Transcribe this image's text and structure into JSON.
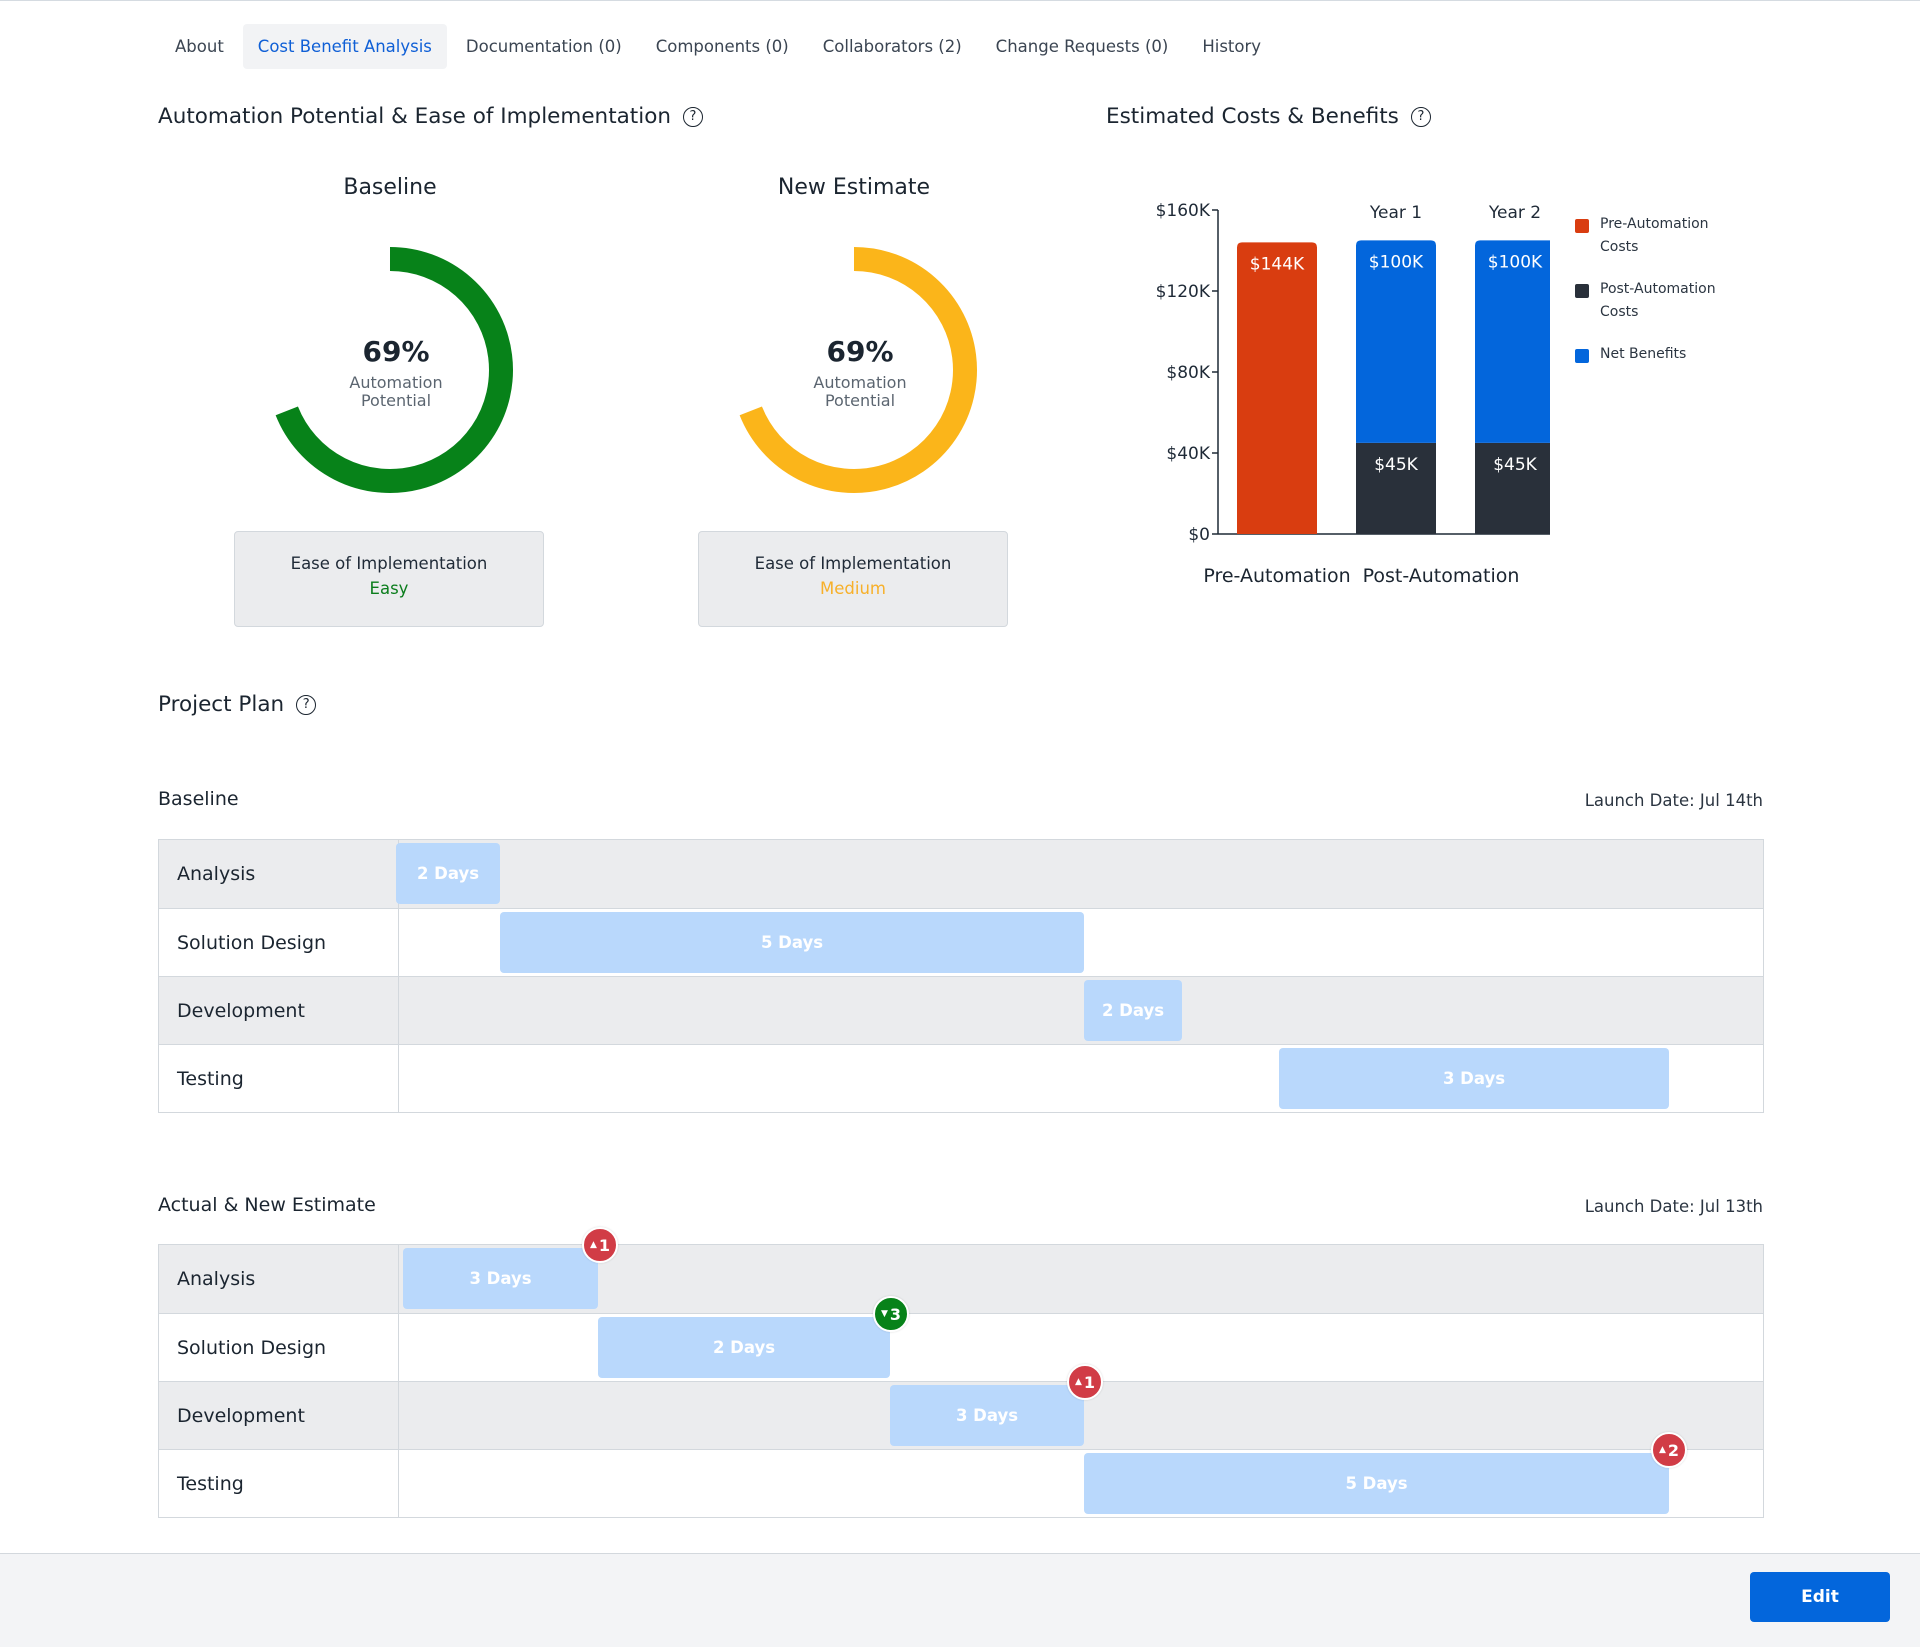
{
  "tabs": [
    {
      "label": "About",
      "active": false
    },
    {
      "label": "Cost Benefit Analysis",
      "active": true
    },
    {
      "label": "Documentation (0)",
      "active": false
    },
    {
      "label": "Components (0)",
      "active": false
    },
    {
      "label": "Collaborators (2)",
      "active": false
    },
    {
      "label": "Change Requests (0)",
      "active": false
    },
    {
      "label": "History",
      "active": false
    }
  ],
  "automation": {
    "heading": "Automation Potential & Ease of Implementation",
    "help_icon": "question-circle-icon",
    "help_glyph": "?",
    "baseline": {
      "title": "Baseline",
      "percent_label": "69%",
      "percent": 69,
      "sub_line1": "Automation",
      "sub_line2": "Potential",
      "color": "#078219",
      "ease_label": "Ease of Implementation",
      "ease_value": "Easy",
      "ease_color": "#0b7d1c"
    },
    "new_estimate": {
      "title": "New Estimate",
      "percent_label": "69%",
      "percent": 69,
      "sub_line1": "Automation",
      "sub_line2": "Potential",
      "color": "#fbb51a",
      "ease_label": "Ease of Implementation",
      "ease_value": "Medium",
      "ease_color": "#f7b02a"
    }
  },
  "costs": {
    "heading": "Estimated Costs & Benefits",
    "help_glyph": "?"
  },
  "chart_data": {
    "type": "bar",
    "stacked": true,
    "title": "Estimated Costs & Benefits",
    "categories": [
      "Pre-Automation",
      "Year 1",
      "Year 2"
    ],
    "group_labels": [
      "Pre-Automation",
      "Post-Automation"
    ],
    "column_labels": [
      "",
      "Year 1",
      "Year 2"
    ],
    "series": [
      {
        "name": "Pre-Automation Costs",
        "color": "#d93d10",
        "values": [
          144,
          0,
          0
        ],
        "labels": [
          "$144K",
          "",
          ""
        ]
      },
      {
        "name": "Post-Automation Costs",
        "color": "#29303a",
        "values": [
          0,
          45,
          45
        ],
        "labels": [
          "",
          "$45K",
          "$45K"
        ]
      },
      {
        "name": "Net Benefits",
        "color": "#0366dc",
        "values": [
          0,
          100,
          100
        ],
        "labels": [
          "",
          "$100K",
          "$100K"
        ]
      }
    ],
    "units": "thousands USD",
    "yticks": [
      0,
      40,
      80,
      120,
      160
    ],
    "ytick_labels": [
      "$0",
      "$40K",
      "$80K",
      "$120K",
      "$160K"
    ],
    "ylim": [
      0,
      160
    ],
    "xlabel": "",
    "ylabel": "",
    "grid": false,
    "legend_position": "right"
  },
  "legend": [
    {
      "label": "Pre-Automation Costs",
      "color": "#d93d10"
    },
    {
      "label": "Post-Automation Costs",
      "color": "#29303a"
    },
    {
      "label": "Net Benefits",
      "color": "#0366dc"
    }
  ],
  "project_plan": {
    "heading": "Project Plan",
    "help_glyph": "?",
    "baseline": {
      "title": "Baseline",
      "launch_date": "Launch Date: Jul 14th",
      "rows": [
        {
          "phase": "Analysis",
          "duration": "2 Days",
          "days": 2
        },
        {
          "phase": "Solution Design",
          "duration": "5 Days",
          "days": 5
        },
        {
          "phase": "Development",
          "duration": "2 Days",
          "days": 2
        },
        {
          "phase": "Testing",
          "duration": "3 Days",
          "days": 3
        }
      ]
    },
    "actual": {
      "title": "Actual & New Estimate",
      "launch_date": "Launch Date: Jul 13th",
      "rows": [
        {
          "phase": "Analysis",
          "duration": "3 Days",
          "days": 3,
          "delta": {
            "direction": "up",
            "arrow": "▲",
            "value": "1",
            "color": "#d13c46"
          }
        },
        {
          "phase": "Solution Design",
          "duration": "2 Days",
          "days": 2,
          "delta": {
            "direction": "down",
            "arrow": "▼",
            "value": "3",
            "color": "#078219"
          }
        },
        {
          "phase": "Development",
          "duration": "3 Days",
          "days": 3,
          "delta": {
            "direction": "up",
            "arrow": "▲",
            "value": "1",
            "color": "#d13c46"
          }
        },
        {
          "phase": "Testing",
          "duration": "5 Days",
          "days": 5,
          "delta": {
            "direction": "up",
            "arrow": "▲",
            "value": "2",
            "color": "#d13c46"
          }
        }
      ]
    }
  },
  "footer": {
    "edit_label": "Edit"
  }
}
